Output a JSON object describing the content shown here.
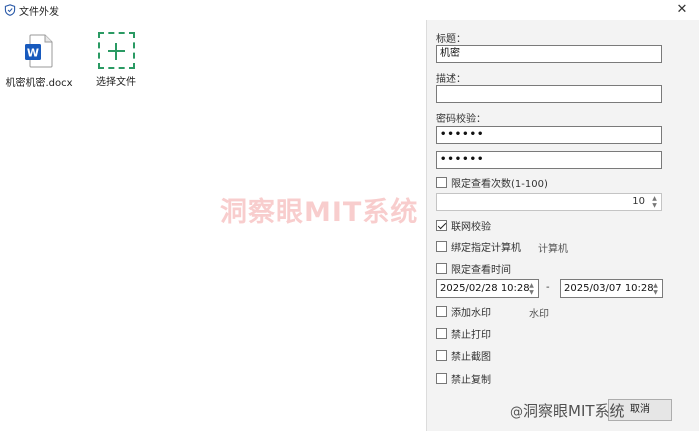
{
  "window": {
    "title": "文件外发",
    "close_glyph": "✕",
    "icon": "shield-icon"
  },
  "files": [
    {
      "name": "机密机密.docx",
      "icon": "word-document-icon"
    }
  ],
  "add_file": {
    "label": "选择文件",
    "icon": "plus-icon"
  },
  "form": {
    "title_label": "标题：",
    "title_value": "机密",
    "desc_label": "描述：",
    "desc_value": "",
    "password_label": "密码校验：",
    "password_value": "••••••",
    "password_confirm_value": "••••••",
    "view_limit": {
      "label": "限定查看次数(1-100)",
      "checked": false,
      "value": "10"
    },
    "online_check": {
      "label": "联网校验",
      "checked": true
    },
    "bind_computer": {
      "label": "绑定指定计算机",
      "checked": false,
      "side_label": "计算机"
    },
    "view_time": {
      "label": "限定查看时间",
      "checked": false,
      "start": "2025/02/28 10:28",
      "separator": "-",
      "end": "2025/03/07 10:28"
    },
    "watermark": {
      "label": "添加水印",
      "checked": false,
      "side_label": "水印"
    },
    "no_print": {
      "label": "禁止打印",
      "checked": false
    },
    "no_screenshot": {
      "label": "禁止截图",
      "checked": false
    },
    "no_copy": {
      "label": "禁止复制",
      "checked": false
    }
  },
  "footer": {
    "cancel_label": "取消"
  },
  "overlays": {
    "center_watermark": "洞察眼MIT系统",
    "brand_at": "@",
    "brand_text": "洞察眼MIT系统"
  },
  "colors": {
    "accent_green": "#2a9a63",
    "word_blue": "#185abd",
    "watermark_red": "#e63b3b"
  }
}
